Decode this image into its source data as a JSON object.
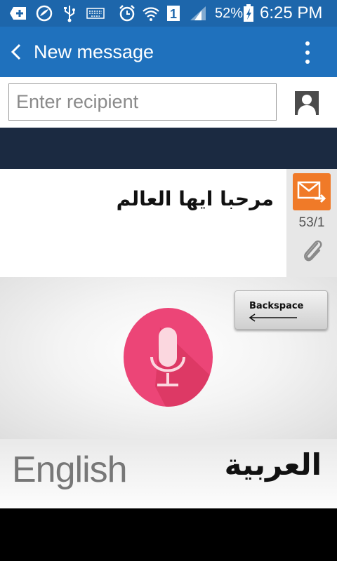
{
  "status_bar": {
    "battery_percent": "52%",
    "sim_slot": "1",
    "time": "6:25 PM",
    "icons": [
      "add-icon",
      "browser-icon",
      "usb-icon",
      "keyboard-icon",
      "alarm-icon",
      "wifi-icon",
      "sim-icon",
      "signal-icon",
      "battery-charging-icon"
    ]
  },
  "action_bar": {
    "title": "New message",
    "back_icon": "chevron-left-icon",
    "menu_icon": "overflow-menu-icon"
  },
  "recipient": {
    "placeholder": "Enter recipient",
    "value": "",
    "contact_icon": "contact-icon"
  },
  "compose": {
    "text": "مرحبا ايها العالم",
    "counter": "53/1",
    "send_icon": "send-message-icon",
    "attach_icon": "paperclip-icon"
  },
  "voice_keyboard": {
    "backspace_label": "Backspace",
    "mic_icon": "microphone-icon",
    "language_left": "English",
    "language_right": "العربية"
  },
  "colors": {
    "status_bar": "#1d66ab",
    "action_bar": "#1f71bd",
    "send_button": "#f07a28",
    "mic_button": "#ec4577"
  }
}
